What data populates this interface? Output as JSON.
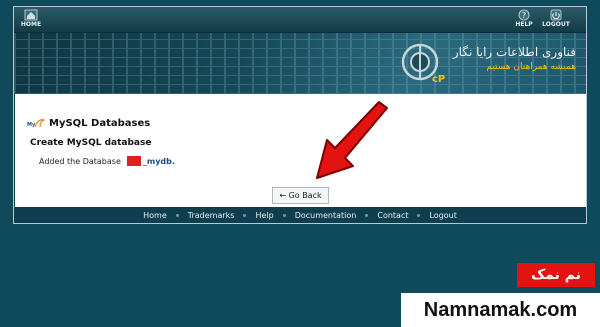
{
  "topbar": {
    "home_label": "HOME",
    "help_label": "HELP",
    "logout_label": "LOGOUT"
  },
  "banner": {
    "brand_line1": "فناوری اطلاعات رایا نگار",
    "brand_line2": "همیشه همراهتان هستیم",
    "logo_text": "cP"
  },
  "content": {
    "section_title": "MySQL Databases",
    "subtitle": "Create MySQL database",
    "added_prefix": "Added the Database",
    "db_name": "_mydb.",
    "go_back_label": "← Go Back"
  },
  "footer": {
    "links": [
      "Home",
      "Trademarks",
      "Help",
      "Documentation",
      "Contact",
      "Logout"
    ]
  },
  "watermark": {
    "persian": "نم نمک",
    "site": "Namnamak.com"
  },
  "colors": {
    "background": "#0e4a5c",
    "arrow": "#e3140f",
    "link": "#1b4f8a"
  }
}
